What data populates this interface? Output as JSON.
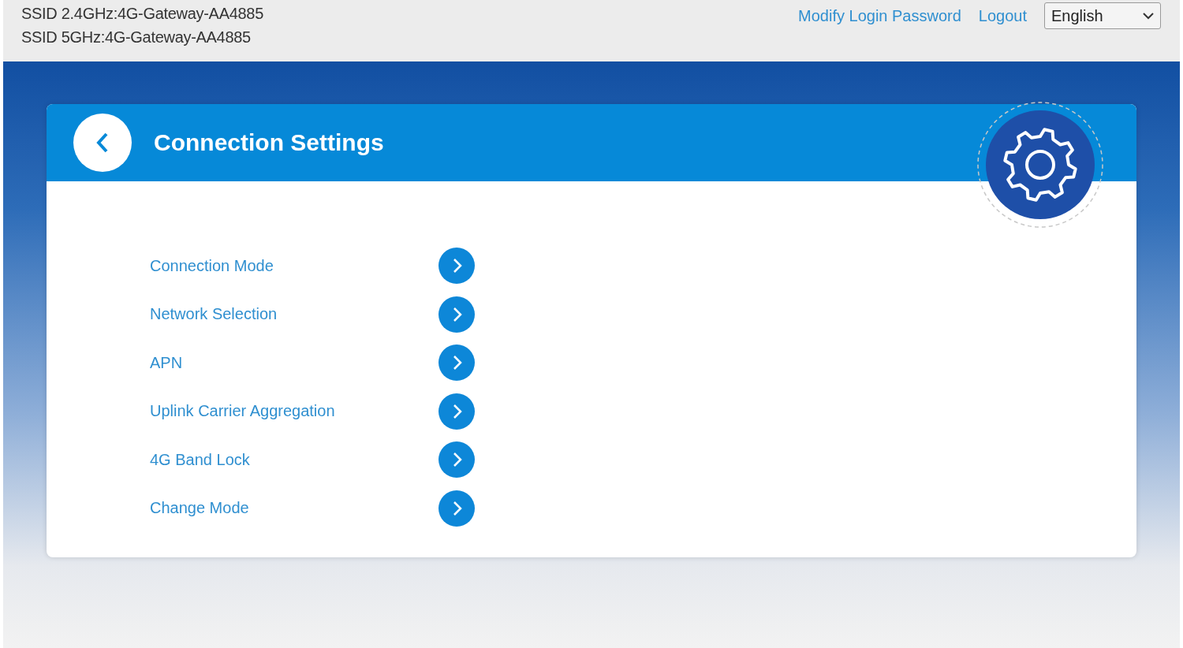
{
  "ssid": [
    "SSID 2.4GHz:4G-Gateway-AA4885",
    "SSID 5GHz:4G-Gateway-AA4885"
  ],
  "header_links": [
    "Modify Login Password",
    "Logout"
  ],
  "language": {
    "value": "English"
  },
  "card": {
    "title": "Connection Settings"
  },
  "menu": [
    {
      "label": "Connection Mode"
    },
    {
      "label": "Network Selection"
    },
    {
      "label": "APN"
    },
    {
      "label": "Uplink Carrier Aggregation"
    },
    {
      "label": "4G Band Lock"
    },
    {
      "label": "Change Mode"
    }
  ]
}
